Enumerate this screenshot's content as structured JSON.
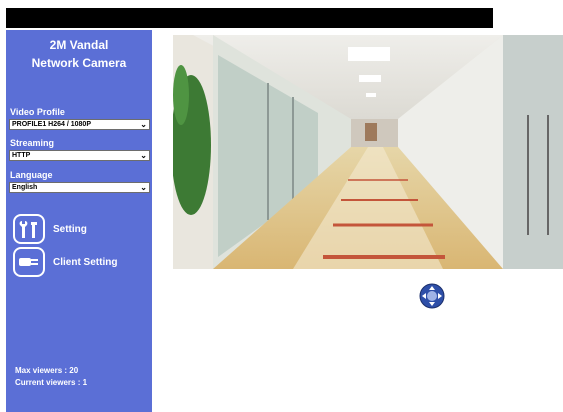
{
  "header": {
    "title_bar": ""
  },
  "sidebar": {
    "brand_line1": "2M Vandal",
    "brand_line2": "Network Camera",
    "video_profile": {
      "label": "Video Profile",
      "value": "PROFILE1 H264 / 1080P"
    },
    "streaming": {
      "label": "Streaming",
      "value": "HTTP"
    },
    "language": {
      "label": "Language",
      "value": "English"
    },
    "menu": {
      "setting": "Setting",
      "client_setting": "Client Setting"
    },
    "max_viewers": "Max viewers : 20",
    "current_viewers": "Current viewers : 1"
  },
  "colors": {
    "sidebar_bg": "#5b6fd6",
    "accent": "#2e4fa8"
  },
  "icons": {
    "setting": "tools-icon",
    "client_setting": "plug-icon",
    "ptz": "ptz-control-icon"
  }
}
